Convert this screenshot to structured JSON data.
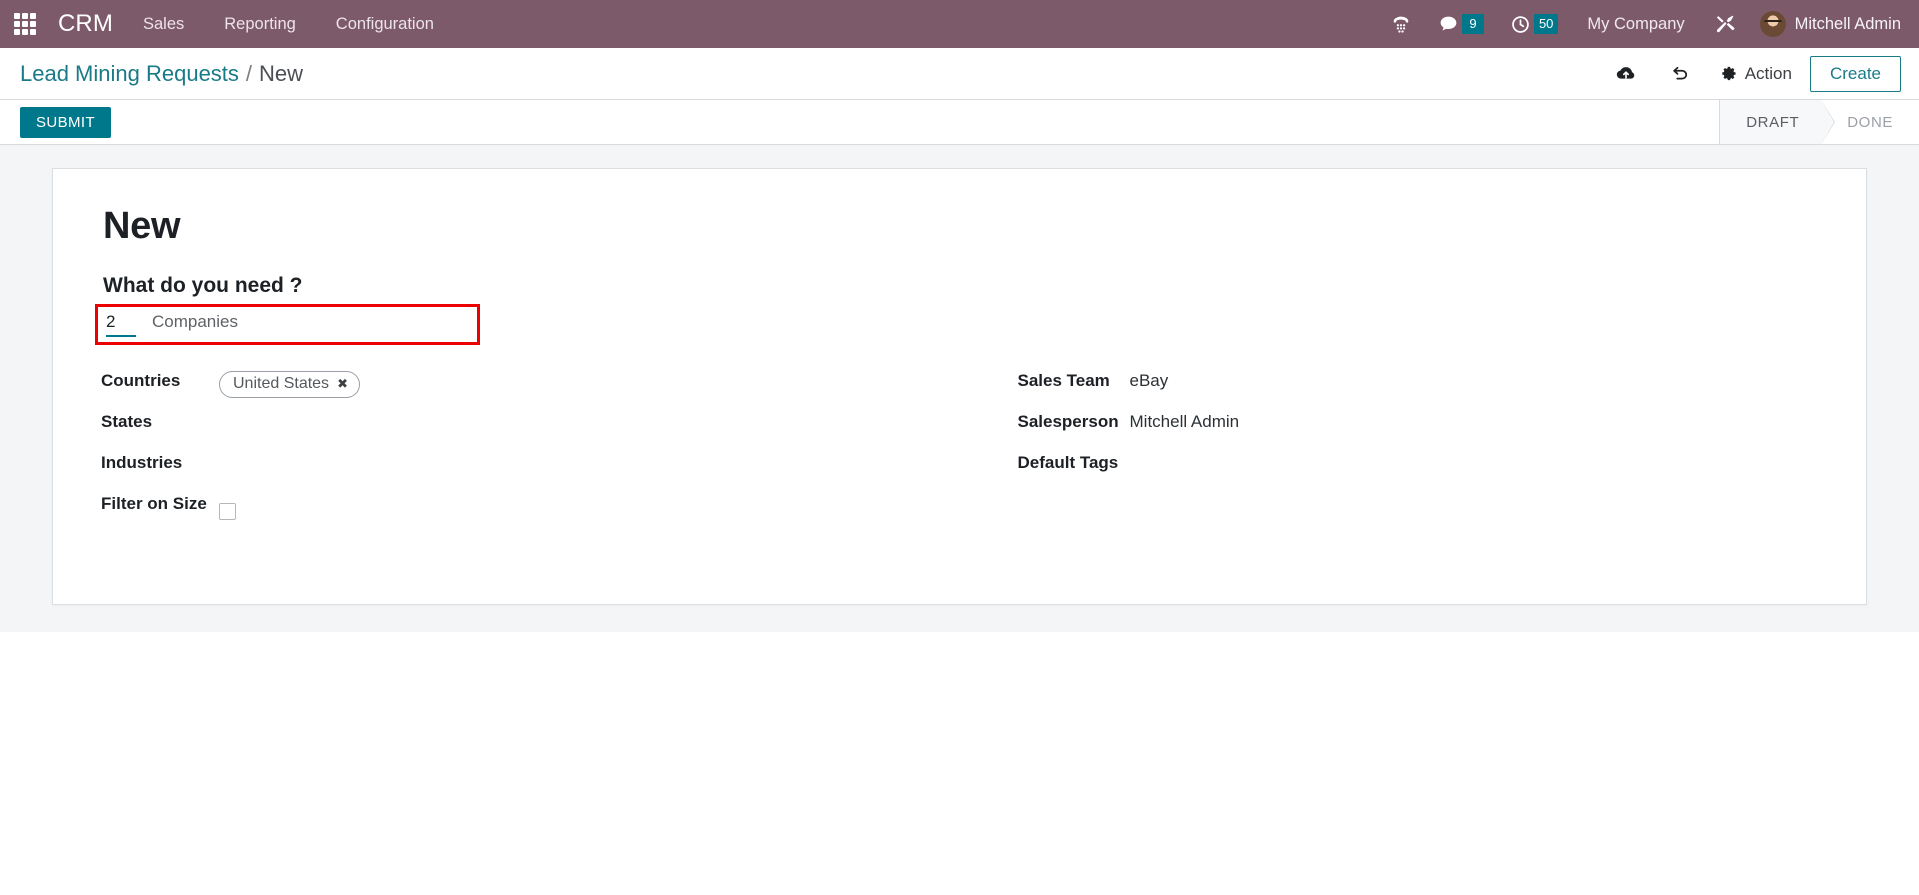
{
  "navbar": {
    "apps_icon": "apps-grid-icon",
    "brand": "CRM",
    "menus": [
      {
        "label": "Sales"
      },
      {
        "label": "Reporting"
      },
      {
        "label": "Configuration"
      }
    ],
    "systray": {
      "phone_icon": "dialpad-phone-icon",
      "messages_icon": "chat-bubble-icon",
      "messages_count": "9",
      "activities_icon": "clock-icon",
      "activities_count": "50",
      "company": "My Company",
      "debug_icon": "tools-wrench-icon",
      "user": "Mitchell Admin",
      "badge_color": "#00788c"
    }
  },
  "control_panel": {
    "breadcrumb_root": "Lead Mining Requests",
    "breadcrumb_separator": "/",
    "breadcrumb_current": "New",
    "save_icon": "cloud-upload-icon",
    "discard_icon": "undo-arrow-icon",
    "action_icon": "gear-icon",
    "action_label": "Action",
    "create_label": "Create",
    "accent_color": "#1a7b88"
  },
  "button_bar": {
    "submit_label": "SUBMIT",
    "statuses": [
      {
        "label": "DRAFT",
        "active": true
      },
      {
        "label": "DONE",
        "active": false
      }
    ]
  },
  "form": {
    "record_title": "New",
    "section_heading": "What do you need ?",
    "count": {
      "value": "2",
      "label": "Companies",
      "highlight_color": "#ec0000"
    },
    "left_fields": [
      {
        "label": "Countries",
        "value": "",
        "tag": "United States"
      },
      {
        "label": "States",
        "value": ""
      },
      {
        "label": "Industries",
        "value": ""
      },
      {
        "label": "Filter on Size",
        "value": "",
        "checkbox": false
      }
    ],
    "right_fields": [
      {
        "label": "Sales Team",
        "value": "eBay"
      },
      {
        "label": "Salesperson",
        "value": "Mitchell Admin"
      },
      {
        "label": "Default Tags",
        "value": ""
      }
    ]
  }
}
